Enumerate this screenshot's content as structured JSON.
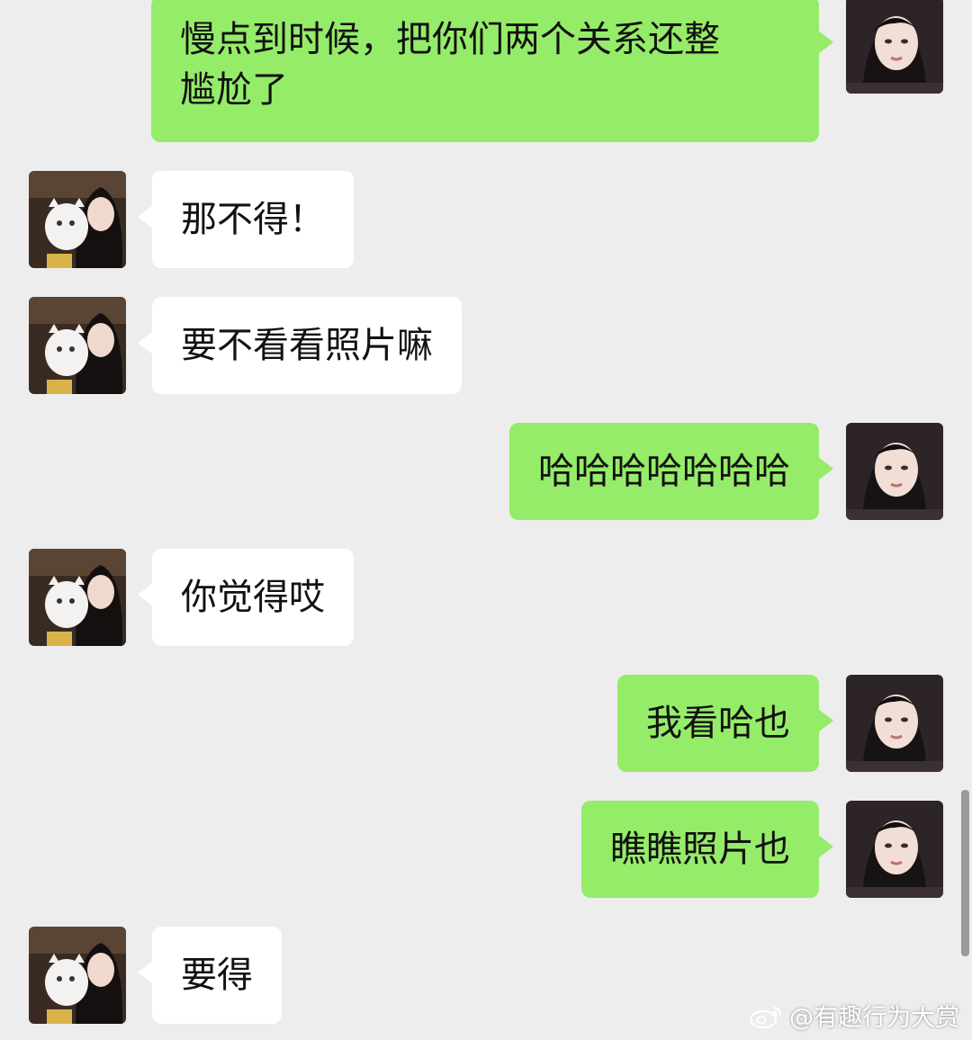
{
  "chat": {
    "messages": [
      {
        "side": "right",
        "text": "慢点到时候，把你们两个关系还整\n尴尬了"
      },
      {
        "side": "left",
        "text": "那不得！"
      },
      {
        "side": "left",
        "text": "要不看看照片嘛"
      },
      {
        "side": "right",
        "text": "哈哈哈哈哈哈哈"
      },
      {
        "side": "left",
        "text": "你觉得哎"
      },
      {
        "side": "right",
        "text": "我看哈也"
      },
      {
        "side": "right",
        "text": "瞧瞧照片也"
      },
      {
        "side": "left",
        "text": "要得"
      }
    ]
  },
  "watermark": {
    "text": "@有趣行为大赏",
    "icon": "weibo-icon"
  },
  "colors": {
    "background": "#ededed",
    "bubble_self": "#95ec69",
    "bubble_other": "#ffffff",
    "text": "#111111"
  }
}
